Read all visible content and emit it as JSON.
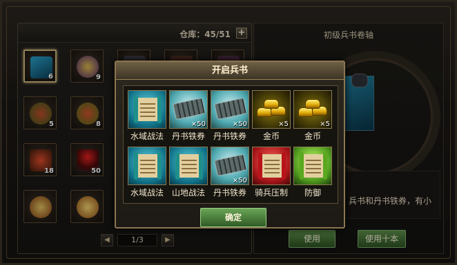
{
  "inventory": {
    "capacity_label": "仓库：45/51",
    "expand_button": "+",
    "items": [
      {
        "qty": "6",
        "icon": "blue-scroll-case-icon"
      },
      {
        "qty": "9",
        "icon": "gold-sack-icon"
      },
      {
        "qty": "",
        "icon": "item-icon"
      },
      {
        "qty": "",
        "icon": "item-icon"
      },
      {
        "qty": "",
        "icon": "item-icon"
      },
      {
        "qty": "5",
        "icon": "rune-pouch-icon"
      },
      {
        "qty": "8",
        "icon": "rune-pouch-icon"
      },
      {
        "qty": "18",
        "icon": "red-charm-icon"
      },
      {
        "qty": "50",
        "icon": "red-flower-pot-icon"
      },
      {
        "qty": "",
        "icon": "golden-emblem-icon"
      },
      {
        "qty": "",
        "icon": "golden-medal-icon"
      }
    ],
    "pager": {
      "prev": "◀",
      "page": "1/3",
      "next": "▶"
    }
  },
  "detail": {
    "title": "初级兵书卷轴",
    "description": "兵书和丹书铁券，有小",
    "use_button": "使用",
    "use_ten_button": "使用十本"
  },
  "modal": {
    "title": "开启兵书",
    "confirm_button": "确定",
    "rewards": [
      {
        "name": "水域战法",
        "mult": "",
        "kind": "scroll-teal"
      },
      {
        "name": "丹书铁券",
        "mult": "×50",
        "kind": "iron"
      },
      {
        "name": "丹书铁券",
        "mult": "×50",
        "kind": "iron"
      },
      {
        "name": "金币",
        "mult": "×5",
        "kind": "gold"
      },
      {
        "name": "金币",
        "mult": "×5",
        "kind": "gold"
      },
      {
        "name": "水域战法",
        "mult": "",
        "kind": "scroll-teal"
      },
      {
        "name": "山地战法",
        "mult": "",
        "kind": "scroll-teal"
      },
      {
        "name": "丹书铁券",
        "mult": "×50",
        "kind": "iron"
      },
      {
        "name": "骑兵压制",
        "mult": "",
        "kind": "scroll-red"
      },
      {
        "name": "防御",
        "mult": "",
        "kind": "scroll-green"
      }
    ]
  }
}
